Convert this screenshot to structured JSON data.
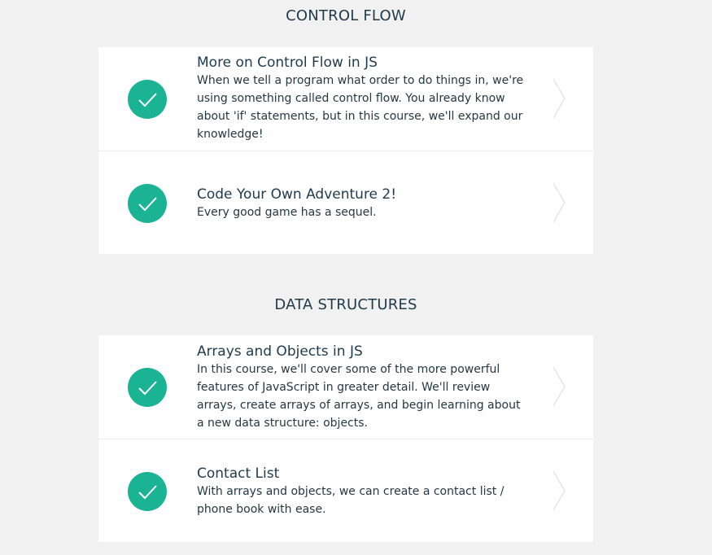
{
  "sections": [
    {
      "title": "CONTROL FLOW",
      "items": [
        {
          "title": "More on Control Flow in JS",
          "description": "When we tell a program what order to do things in, we're using something called control flow. You already know about 'if' statements, but in this course, we'll expand our knowledge!",
          "completed": true
        },
        {
          "title": "Code Your Own Adventure 2!",
          "description": "Every good game has a sequel.",
          "completed": true
        }
      ]
    },
    {
      "title": "DATA STRUCTURES",
      "items": [
        {
          "title": "Arrays and Objects in JS",
          "description": "In this course, we'll cover some of the more powerful features of JavaScript in greater detail. We'll review arrays, create arrays of arrays, and begin learning about a new data structure: objects.",
          "completed": true
        },
        {
          "title": "Contact List",
          "description": "With arrays and objects, we can create a contact list / phone book with ease.",
          "completed": true
        }
      ]
    }
  ],
  "icons": {
    "status": "checkmark-icon",
    "open": "chevron-right-icon"
  },
  "colors": {
    "accent": "#1ab394",
    "heading": "#1f3a4d",
    "background": "#f0f1f0",
    "card": "#ffffff"
  }
}
